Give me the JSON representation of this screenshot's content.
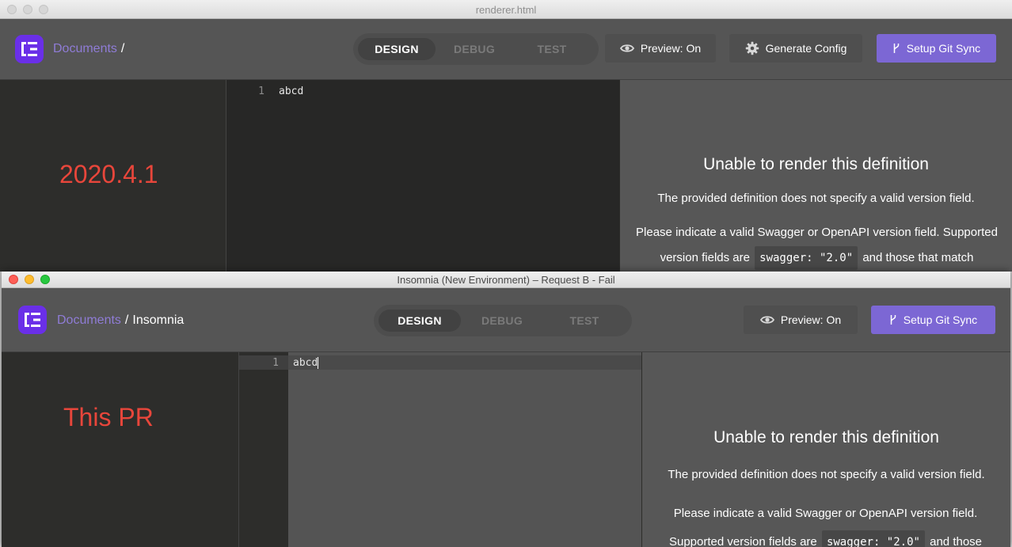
{
  "back_window": {
    "title": "renderer.html",
    "breadcrumb": {
      "link": "Documents",
      "separator": "/",
      "current": ""
    },
    "tabs": [
      "DESIGN",
      "DEBUG",
      "TEST"
    ],
    "active_tab": "DESIGN",
    "preview_label": "Preview: On",
    "generate_config_label": "Generate Config",
    "git_sync_label": "Setup Git Sync",
    "annotation": "2020.4.1",
    "editor": {
      "line_number": "1",
      "code": "abcd"
    },
    "preview": {
      "title": "Unable to render this definition",
      "description": "The provided definition does not specify a valid version field.",
      "hint_prefix": "Please indicate a valid Swagger or OpenAPI version field. Supported version fields are",
      "hint_code": "swagger: \"2.0\"",
      "hint_suffix": "and those that match"
    }
  },
  "front_window": {
    "title": "Insomnia (New Environment) – Request B - Fail",
    "breadcrumb": {
      "link": "Documents",
      "separator": "/",
      "current": "Insomnia"
    },
    "tabs": [
      "DESIGN",
      "DEBUG",
      "TEST"
    ],
    "active_tab": "DESIGN",
    "preview_label": "Preview: On",
    "git_sync_label": "Setup Git Sync",
    "annotation": "This PR",
    "editor": {
      "line_number": "1",
      "code": "abcd"
    },
    "preview": {
      "title": "Unable to render this definition",
      "description": "The provided definition does not specify a valid version field.",
      "hint_prefix": "Please indicate a valid Swagger or OpenAPI version field. Supported version fields are",
      "hint_code": "swagger: \"2.0\"",
      "hint_suffix": "and those"
    }
  },
  "icons": {
    "logo": "insomnia-logo-icon",
    "preview": "eye-icon",
    "config": "gear-icon",
    "git": "git-branch-icon"
  },
  "colors": {
    "accent_purple": "#7c67d4",
    "logo_purple": "#6a2fe8",
    "link_purple": "#8f7cd6",
    "annotation_red": "#e8463b"
  }
}
